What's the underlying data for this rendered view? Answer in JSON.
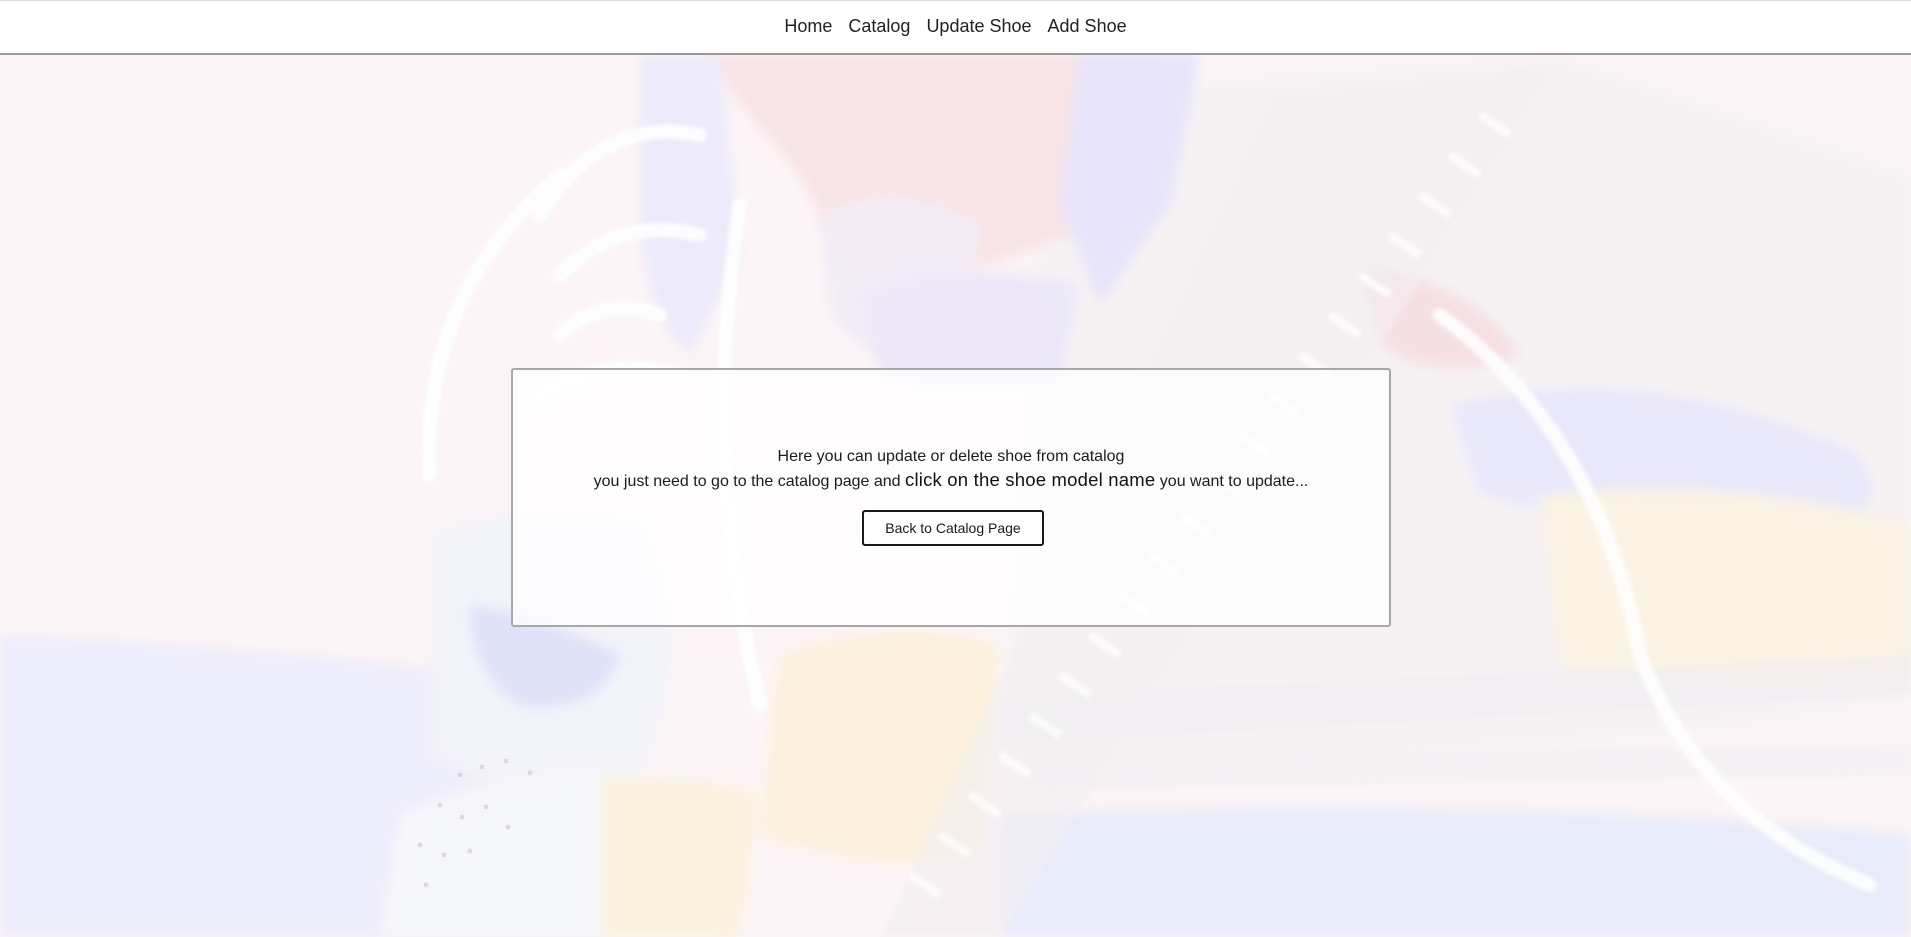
{
  "nav": {
    "home": "Home",
    "catalog": "Catalog",
    "update_shoe": "Update Shoe",
    "add_shoe": "Add Shoe"
  },
  "card": {
    "line1": "Here you can update or delete shoe from catalog",
    "line2_before": "you just need to go to the catalog page and ",
    "line2_strong": "click on the shoe model name",
    "line2_after": " you want to update...",
    "button_label": "Back to Catalog Page"
  },
  "colors": {
    "nav_background": "#ffffff",
    "button_border": "#1a1a1a",
    "card_border": "#a8a8a8"
  }
}
